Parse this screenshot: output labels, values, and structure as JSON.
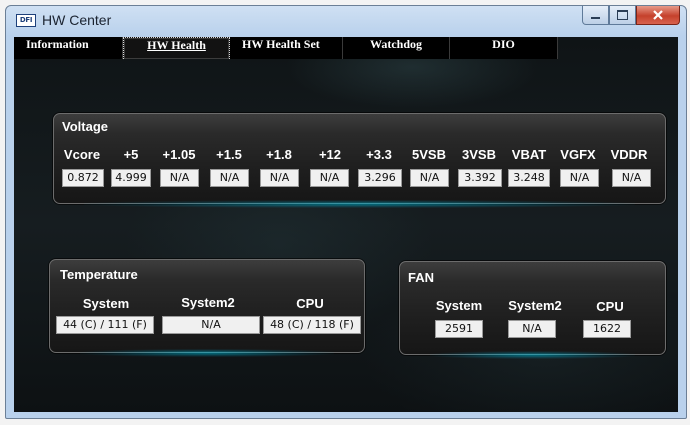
{
  "window": {
    "title": "HW Center",
    "icon_text": "DFI"
  },
  "tabs": [
    {
      "label": "Information"
    },
    {
      "label": "HW Health"
    },
    {
      "label": "HW Health Set"
    },
    {
      "label": "Watchdog"
    },
    {
      "label": "DIO"
    }
  ],
  "voltage": {
    "title": "Voltage",
    "headers": [
      "Vcore",
      "+5",
      "+1.05",
      "+1.5",
      "+1.8",
      "+12",
      "+3.3",
      "5VSB",
      "3VSB",
      "VBAT",
      "VGFX",
      "VDDR"
    ],
    "values": [
      "0.872",
      "4.999",
      "N/A",
      "N/A",
      "N/A",
      "N/A",
      "3.296",
      "N/A",
      "3.392",
      "3.248",
      "N/A",
      "N/A"
    ]
  },
  "temperature": {
    "title": "Temperature",
    "headers": [
      "System",
      "System2",
      "CPU"
    ],
    "values": [
      "44 (C) / 111 (F)",
      "N/A",
      "48 (C) / 118 (F)"
    ]
  },
  "fan": {
    "title": "FAN",
    "headers": [
      "System",
      "System2",
      "CPU"
    ],
    "values": [
      "2591",
      "N/A",
      "1622"
    ]
  }
}
